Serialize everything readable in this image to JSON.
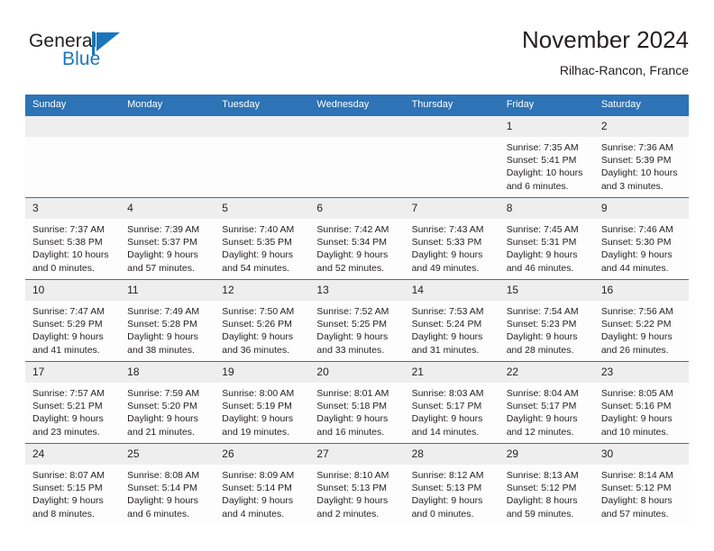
{
  "brand": {
    "name_part1": "General",
    "name_part2": "Blue",
    "logo_icon": "triangle-flag-icon",
    "accent_color": "#1b75bb"
  },
  "header": {
    "title": "November 2024",
    "location": "Rilhac-Rancon, France"
  },
  "theme": {
    "header_bar_color": "#2d73b5",
    "daynum_band_color": "#eeeeee",
    "text_color": "#231f20",
    "cell_bg_color": "#fdfdfd"
  },
  "calendar": {
    "weekday_headers": [
      "Sunday",
      "Monday",
      "Tuesday",
      "Wednesday",
      "Thursday",
      "Friday",
      "Saturday"
    ],
    "labels": {
      "sunrise_prefix": "Sunrise: ",
      "sunset_prefix": "Sunset: ",
      "daylight_prefix": "Daylight: "
    },
    "weeks": [
      [
        {
          "day": "",
          "sunrise": "",
          "sunset": "",
          "daylight": "",
          "blank": true
        },
        {
          "day": "",
          "sunrise": "",
          "sunset": "",
          "daylight": "",
          "blank": true
        },
        {
          "day": "",
          "sunrise": "",
          "sunset": "",
          "daylight": "",
          "blank": true
        },
        {
          "day": "",
          "sunrise": "",
          "sunset": "",
          "daylight": "",
          "blank": true
        },
        {
          "day": "",
          "sunrise": "",
          "sunset": "",
          "daylight": "",
          "blank": true
        },
        {
          "day": "1",
          "sunrise": "Sunrise: 7:35 AM",
          "sunset": "Sunset: 5:41 PM",
          "daylight": "Daylight: 10 hours and 6 minutes."
        },
        {
          "day": "2",
          "sunrise": "Sunrise: 7:36 AM",
          "sunset": "Sunset: 5:39 PM",
          "daylight": "Daylight: 10 hours and 3 minutes."
        }
      ],
      [
        {
          "day": "3",
          "sunrise": "Sunrise: 7:37 AM",
          "sunset": "Sunset: 5:38 PM",
          "daylight": "Daylight: 10 hours and 0 minutes."
        },
        {
          "day": "4",
          "sunrise": "Sunrise: 7:39 AM",
          "sunset": "Sunset: 5:37 PM",
          "daylight": "Daylight: 9 hours and 57 minutes."
        },
        {
          "day": "5",
          "sunrise": "Sunrise: 7:40 AM",
          "sunset": "Sunset: 5:35 PM",
          "daylight": "Daylight: 9 hours and 54 minutes."
        },
        {
          "day": "6",
          "sunrise": "Sunrise: 7:42 AM",
          "sunset": "Sunset: 5:34 PM",
          "daylight": "Daylight: 9 hours and 52 minutes."
        },
        {
          "day": "7",
          "sunrise": "Sunrise: 7:43 AM",
          "sunset": "Sunset: 5:33 PM",
          "daylight": "Daylight: 9 hours and 49 minutes."
        },
        {
          "day": "8",
          "sunrise": "Sunrise: 7:45 AM",
          "sunset": "Sunset: 5:31 PM",
          "daylight": "Daylight: 9 hours and 46 minutes."
        },
        {
          "day": "9",
          "sunrise": "Sunrise: 7:46 AM",
          "sunset": "Sunset: 5:30 PM",
          "daylight": "Daylight: 9 hours and 44 minutes."
        }
      ],
      [
        {
          "day": "10",
          "sunrise": "Sunrise: 7:47 AM",
          "sunset": "Sunset: 5:29 PM",
          "daylight": "Daylight: 9 hours and 41 minutes."
        },
        {
          "day": "11",
          "sunrise": "Sunrise: 7:49 AM",
          "sunset": "Sunset: 5:28 PM",
          "daylight": "Daylight: 9 hours and 38 minutes."
        },
        {
          "day": "12",
          "sunrise": "Sunrise: 7:50 AM",
          "sunset": "Sunset: 5:26 PM",
          "daylight": "Daylight: 9 hours and 36 minutes."
        },
        {
          "day": "13",
          "sunrise": "Sunrise: 7:52 AM",
          "sunset": "Sunset: 5:25 PM",
          "daylight": "Daylight: 9 hours and 33 minutes."
        },
        {
          "day": "14",
          "sunrise": "Sunrise: 7:53 AM",
          "sunset": "Sunset: 5:24 PM",
          "daylight": "Daylight: 9 hours and 31 minutes."
        },
        {
          "day": "15",
          "sunrise": "Sunrise: 7:54 AM",
          "sunset": "Sunset: 5:23 PM",
          "daylight": "Daylight: 9 hours and 28 minutes."
        },
        {
          "day": "16",
          "sunrise": "Sunrise: 7:56 AM",
          "sunset": "Sunset: 5:22 PM",
          "daylight": "Daylight: 9 hours and 26 minutes."
        }
      ],
      [
        {
          "day": "17",
          "sunrise": "Sunrise: 7:57 AM",
          "sunset": "Sunset: 5:21 PM",
          "daylight": "Daylight: 9 hours and 23 minutes."
        },
        {
          "day": "18",
          "sunrise": "Sunrise: 7:59 AM",
          "sunset": "Sunset: 5:20 PM",
          "daylight": "Daylight: 9 hours and 21 minutes."
        },
        {
          "day": "19",
          "sunrise": "Sunrise: 8:00 AM",
          "sunset": "Sunset: 5:19 PM",
          "daylight": "Daylight: 9 hours and 19 minutes."
        },
        {
          "day": "20",
          "sunrise": "Sunrise: 8:01 AM",
          "sunset": "Sunset: 5:18 PM",
          "daylight": "Daylight: 9 hours and 16 minutes."
        },
        {
          "day": "21",
          "sunrise": "Sunrise: 8:03 AM",
          "sunset": "Sunset: 5:17 PM",
          "daylight": "Daylight: 9 hours and 14 minutes."
        },
        {
          "day": "22",
          "sunrise": "Sunrise: 8:04 AM",
          "sunset": "Sunset: 5:17 PM",
          "daylight": "Daylight: 9 hours and 12 minutes."
        },
        {
          "day": "23",
          "sunrise": "Sunrise: 8:05 AM",
          "sunset": "Sunset: 5:16 PM",
          "daylight": "Daylight: 9 hours and 10 minutes."
        }
      ],
      [
        {
          "day": "24",
          "sunrise": "Sunrise: 8:07 AM",
          "sunset": "Sunset: 5:15 PM",
          "daylight": "Daylight: 9 hours and 8 minutes."
        },
        {
          "day": "25",
          "sunrise": "Sunrise: 8:08 AM",
          "sunset": "Sunset: 5:14 PM",
          "daylight": "Daylight: 9 hours and 6 minutes."
        },
        {
          "day": "26",
          "sunrise": "Sunrise: 8:09 AM",
          "sunset": "Sunset: 5:14 PM",
          "daylight": "Daylight: 9 hours and 4 minutes."
        },
        {
          "day": "27",
          "sunrise": "Sunrise: 8:10 AM",
          "sunset": "Sunset: 5:13 PM",
          "daylight": "Daylight: 9 hours and 2 minutes."
        },
        {
          "day": "28",
          "sunrise": "Sunrise: 8:12 AM",
          "sunset": "Sunset: 5:13 PM",
          "daylight": "Daylight: 9 hours and 0 minutes."
        },
        {
          "day": "29",
          "sunrise": "Sunrise: 8:13 AM",
          "sunset": "Sunset: 5:12 PM",
          "daylight": "Daylight: 8 hours and 59 minutes."
        },
        {
          "day": "30",
          "sunrise": "Sunrise: 8:14 AM",
          "sunset": "Sunset: 5:12 PM",
          "daylight": "Daylight: 8 hours and 57 minutes."
        }
      ]
    ]
  }
}
